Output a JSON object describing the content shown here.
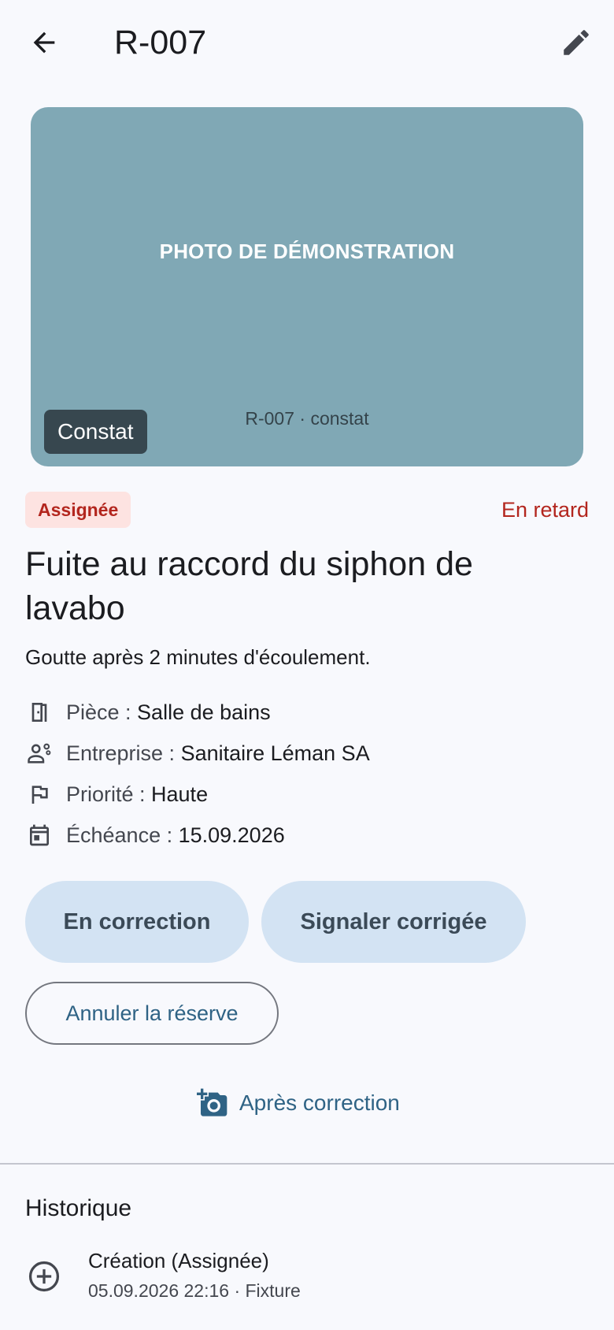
{
  "appbar": {
    "title": "R-007",
    "back_icon": "arrow-back-icon",
    "edit_icon": "pencil-icon"
  },
  "photo": {
    "caption": "PHOTO DE DÉMONSTRATION",
    "subcaption": "R-007 · constat",
    "tag": "Constat",
    "background_color": "#80a8b5"
  },
  "status": {
    "badge": "Assignée",
    "late": "En retard",
    "color": "#b3261e"
  },
  "defect": {
    "title": "Fuite au raccord du siphon de lavabo",
    "description": "Goutte après 2 minutes d'écoulement."
  },
  "details": [
    {
      "icon": "door-icon",
      "label": "Pièce : ",
      "value": "Salle de bains"
    },
    {
      "icon": "engineer-icon",
      "label": "Entreprise : ",
      "value": "Sanitaire Léman SA"
    },
    {
      "icon": "flag-icon",
      "label": "Priorité : ",
      "value": "Haute"
    },
    {
      "icon": "calendar-icon",
      "label": "Échéance : ",
      "value": "15.09.2026"
    }
  ],
  "actions": {
    "in_correction": "En correction",
    "report_fixed": "Signaler corrigée",
    "cancel_reserve": "Annuler la réserve",
    "after_correction": "Après correction",
    "after_correction_icon": "add-photo-icon"
  },
  "history": {
    "title": "Historique",
    "items": [
      {
        "icon": "add-circle-icon",
        "title": "Création (Assignée)",
        "subtitle": "05.09.2026 22:16 · Fixture"
      }
    ]
  }
}
